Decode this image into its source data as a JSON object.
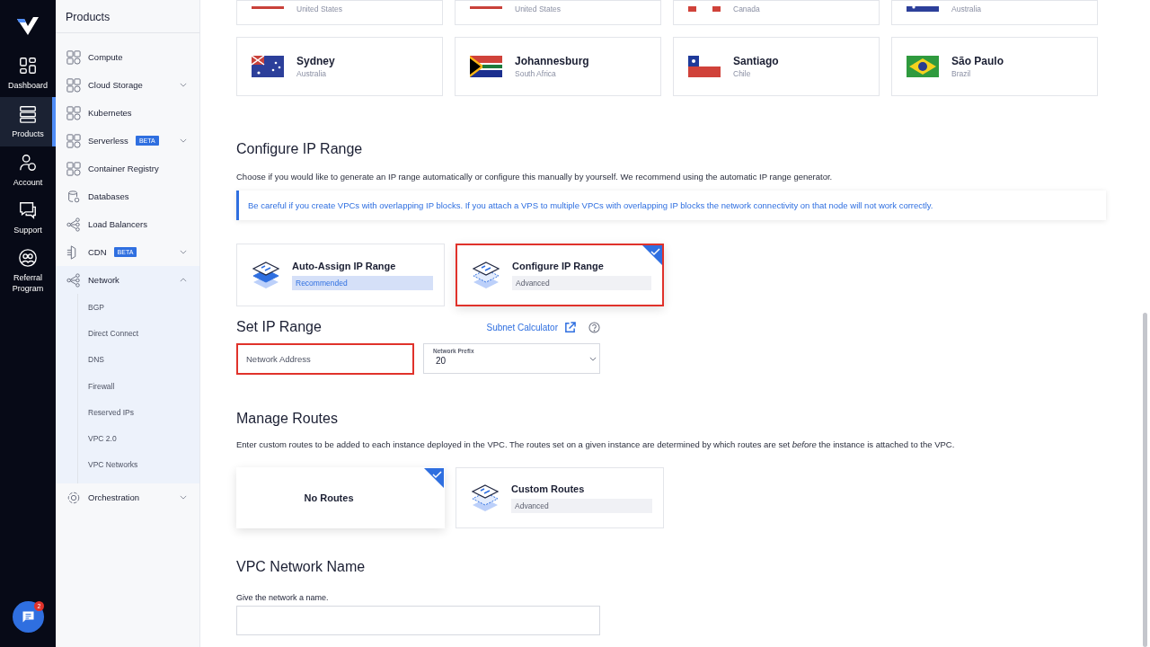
{
  "rail": {
    "items": [
      {
        "label": "Dashboard",
        "selected": false
      },
      {
        "label": "Products",
        "selected": true
      },
      {
        "label": "Account",
        "selected": false
      },
      {
        "label": "Support",
        "selected": false
      },
      {
        "label": "Referral Program",
        "selected": false
      }
    ],
    "chat": {
      "badge": "2"
    }
  },
  "sidebar": {
    "title": "Products",
    "items": [
      {
        "label": "Compute",
        "expandable": false
      },
      {
        "label": "Cloud Storage",
        "expandable": true,
        "expanded": false
      },
      {
        "label": "Kubernetes",
        "expandable": false
      },
      {
        "label": "Serverless",
        "badge": "BETA",
        "expandable": true,
        "expanded": false
      },
      {
        "label": "Container Registry",
        "expandable": false
      },
      {
        "label": "Databases",
        "expandable": false
      },
      {
        "label": "Load Balancers",
        "expandable": false
      },
      {
        "label": "CDN",
        "badge": "BETA",
        "expandable": true,
        "expanded": false
      },
      {
        "label": "Network",
        "expandable": true,
        "expanded": true,
        "children": [
          {
            "label": "BGP"
          },
          {
            "label": "Direct Connect"
          },
          {
            "label": "DNS"
          },
          {
            "label": "Firewall"
          },
          {
            "label": "Reserved IPs"
          },
          {
            "label": "VPC 2.0"
          },
          {
            "label": "VPC Networks"
          }
        ]
      },
      {
        "label": "Orchestration",
        "expandable": true,
        "expanded": false
      }
    ]
  },
  "regions": [
    {
      "country": "United States"
    },
    {
      "country": "United States"
    },
    {
      "country": "Canada"
    },
    {
      "country": "Australia"
    },
    {
      "city": "Sydney",
      "country": "Australia"
    },
    {
      "city": "Johannesburg",
      "country": "South Africa"
    },
    {
      "city": "Santiago",
      "country": "Chile"
    },
    {
      "city": "São Paulo",
      "country": "Brazil"
    }
  ],
  "ip_range": {
    "title": "Configure IP Range",
    "description": "Choose if you would like to generate an IP range automatically or configure this manually by yourself. We recommend using the automatic IP range generator.",
    "alert": "Be careful if you create VPCs with overlapping IP blocks. If you attach a VPS to multiple VPCs with overlapping IP blocks the network connectivity on that node will not work correctly.",
    "options": [
      {
        "title": "Auto-Assign IP Range",
        "tag": "Recommended",
        "kind": "recommended",
        "selected": false,
        "highlighted": false
      },
      {
        "title": "Configure IP Range",
        "tag": "Advanced",
        "kind": "advanced",
        "selected": true,
        "highlighted": true
      }
    ]
  },
  "set_range": {
    "title": "Set IP Range",
    "link": "Subnet Calculator",
    "address_field": {
      "placeholder": "Network Address",
      "highlighted": true
    },
    "prefix_field": {
      "label": "Network Prefix",
      "value": "20"
    }
  },
  "routes": {
    "title": "Manage Routes",
    "description": "Enter custom routes to be added to each instance deployed in the VPC. The routes set on a given instance are determined by which routes are set *before* the instance is attached to the VPC.",
    "options": [
      {
        "title": "No Routes",
        "selected": true
      },
      {
        "title": "Custom Routes",
        "tag": "Advanced",
        "selected": false
      }
    ]
  },
  "name_section": {
    "title": "VPC Network Name",
    "label": "Give the network a name."
  }
}
